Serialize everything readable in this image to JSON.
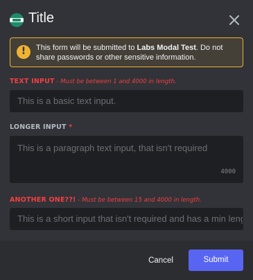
{
  "header": {
    "title": "Title",
    "icon": "app-logo-icon",
    "close_icon": "close-icon"
  },
  "notice": {
    "prefix": "This form will be submitted to ",
    "app_name": "Labs Modal Test",
    "suffix": ". Do not share passwords or other sensitive information.",
    "icon": "warning-icon",
    "color": "#f0b232"
  },
  "fields": [
    {
      "label": "TEXT INPUT",
      "separator": " - ",
      "error": "Must be between 1 and 4000 in length.",
      "placeholder": "This is a basic text input."
    },
    {
      "label": "LONGER INPUT",
      "required_mark": "*",
      "placeholder": "This is a paragraph text input, that isn't required",
      "counter": "4000"
    },
    {
      "label": "ANOTHER ONE??!",
      "separator": " - ",
      "error": "Must be between 15 and 4000 in length.",
      "placeholder": "This is a short input that isn't required and has a min length"
    }
  ],
  "footer": {
    "cancel_label": "Cancel",
    "submit_label": "Submit",
    "submit_color": "#5865f2"
  }
}
